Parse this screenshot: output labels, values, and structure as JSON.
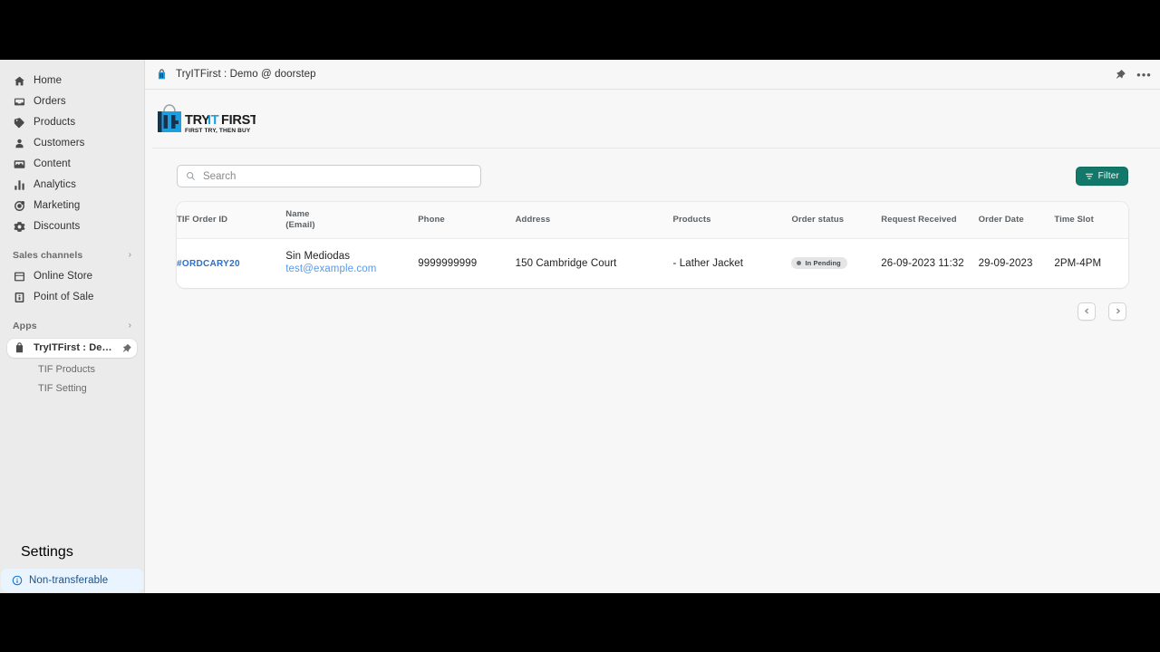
{
  "window": {
    "letterbox_color": "#000000"
  },
  "sidebar": {
    "primary_items": [
      {
        "label": "Home",
        "icon": "home-icon"
      },
      {
        "label": "Orders",
        "icon": "orders-inbox-icon"
      },
      {
        "label": "Products",
        "icon": "products-tag-icon"
      },
      {
        "label": "Customers",
        "icon": "customers-person-icon"
      },
      {
        "label": "Content",
        "icon": "content-icon"
      },
      {
        "label": "Analytics",
        "icon": "analytics-bars-icon"
      },
      {
        "label": "Marketing",
        "icon": "marketing-target-icon"
      },
      {
        "label": "Discounts",
        "icon": "discounts-gear-icon"
      }
    ],
    "sections": [
      {
        "label": "Sales channels",
        "chevron": "›",
        "items": [
          {
            "label": "Online Store",
            "icon": "online-store-icon"
          },
          {
            "label": "Point of Sale",
            "icon": "point-of-sale-icon"
          }
        ]
      },
      {
        "label": "Apps",
        "chevron": "›",
        "items": []
      }
    ],
    "active_app": {
      "label": "TryITFirst : Demo @ d...",
      "icon": "tif-bag-icon",
      "pin_icon": "pin-icon"
    },
    "app_subitems": [
      {
        "label": "TIF Products"
      },
      {
        "label": "TIF Setting"
      }
    ],
    "settings": {
      "label": "Settings",
      "icon": "gear-icon"
    },
    "banner": {
      "label": "Non-transferable",
      "icon": "info-circle-icon",
      "text_color": "#1b4f8a",
      "background": "#eaf4fe"
    }
  },
  "topbar": {
    "app_icon": "tif-bag-icon",
    "title": "TryITFirst : Demo @ doorstep",
    "pin_icon": "pin-icon",
    "more_label": "•••"
  },
  "brand": {
    "logo_word_1": "TRY",
    "logo_word_2": "IT",
    "logo_word_3": "FIRST",
    "tagline": "FIRST TRY, THEN BUY",
    "mark_letters": "TiF",
    "accent_color": "#1b9fe0",
    "dark_color": "#1a1a1a"
  },
  "toolbar": {
    "search_placeholder": "Search",
    "search_value": "",
    "search_icon": "search-icon",
    "filter_label": "Filter",
    "filter_icon": "filter-funnel-icon",
    "filter_color": "#11786a"
  },
  "table": {
    "columns": [
      {
        "key": "order_id",
        "label": "TIF Order ID"
      },
      {
        "key": "name",
        "label": "Name",
        "sublabel": "(Email)"
      },
      {
        "key": "phone",
        "label": "Phone"
      },
      {
        "key": "address",
        "label": "Address"
      },
      {
        "key": "products",
        "label": "Products"
      },
      {
        "key": "status",
        "label": "Order status"
      },
      {
        "key": "received",
        "label": "Request Received"
      },
      {
        "key": "order_date",
        "label": "Order Date"
      },
      {
        "key": "time_slot",
        "label": "Time Slot"
      }
    ],
    "rows": [
      {
        "order_id": "#ORDCARY20",
        "name": "Sin Mediodas",
        "email": "test@example.com",
        "phone": "9999999999",
        "address": "150 Cambridge Court",
        "products": "- Lather Jacket",
        "status": "In Pending",
        "received": "26-09-2023 11:32",
        "order_date": "29-09-2023",
        "time_slot": "2PM-4PM"
      }
    ]
  },
  "pagination": {
    "prev_icon": "chevron-left-icon",
    "next_icon": "chevron-right-icon"
  }
}
